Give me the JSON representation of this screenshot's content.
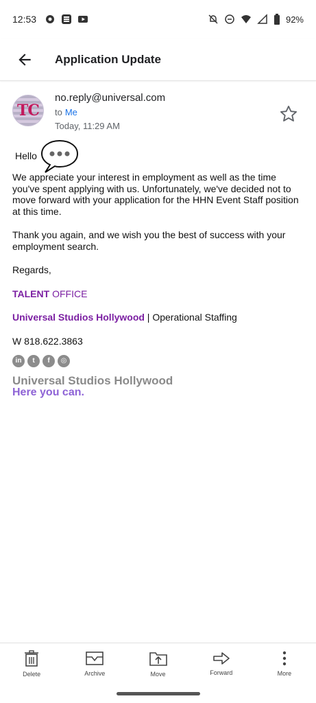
{
  "status_bar": {
    "time": "12:53",
    "battery": "92%"
  },
  "app_bar": {
    "title": "Application Update",
    "back_icon": "arrow-back-icon"
  },
  "message": {
    "sender": "no.reply@universal.com",
    "to_prefix": "to",
    "to_name": "Me",
    "date": "Today, 11:29 AM",
    "avatar_initials": "TC",
    "greeting": "Hello",
    "paragraph1": "We appreciate your interest in employment as well as the time you've spent applying with us.  Unfortunately, we've decided not to move forward with your application for the HHN Event Staff position at this time.",
    "paragraph2": "Thank you again, and we wish you the best of success with your employment search.",
    "regards": "Regards,",
    "sig_talent": "TALENT",
    "sig_office": " OFFICE",
    "sig_company": "Universal Studios Hollywood",
    "sig_dept": " | Operational Staffing",
    "sig_phone": "W 818.622.3863",
    "brand_line1": "Universal Studios Hollywood",
    "brand_line2": "Here you can."
  },
  "bottom_actions": [
    {
      "label": "Delete",
      "icon": "trash-icon"
    },
    {
      "label": "Archive",
      "icon": "archive-icon"
    },
    {
      "label": "Move",
      "icon": "move-icon"
    },
    {
      "label": "Forward",
      "icon": "forward-icon"
    },
    {
      "label": "More",
      "icon": "more-vert-icon"
    }
  ],
  "colors": {
    "accent_purple": "#7b1fa2",
    "link_blue": "#1a73e8"
  }
}
